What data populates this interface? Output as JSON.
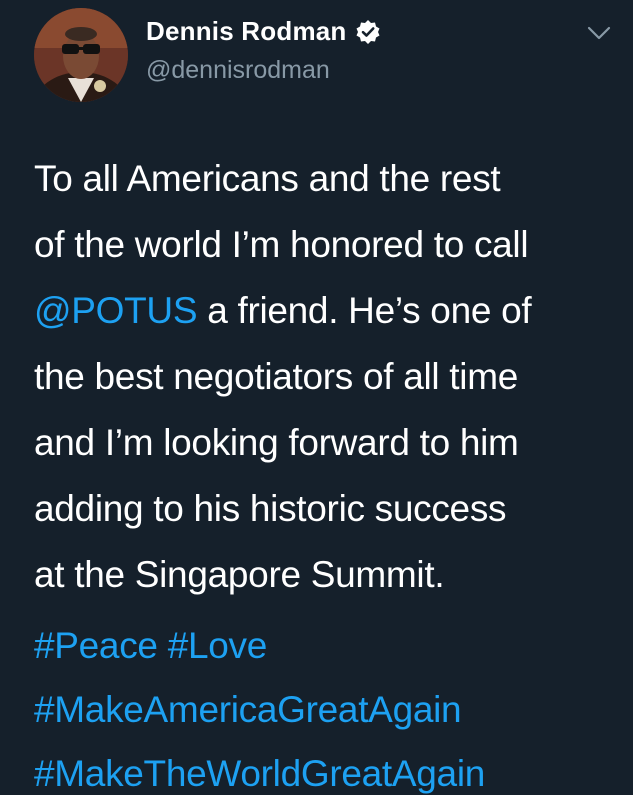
{
  "user": {
    "display_name": "Dennis Rodman",
    "handle": "@dennisrodman",
    "verified": true
  },
  "tweet": {
    "lines": [
      "To all Americans and the rest",
      "of the world I’m honored to call",
      "a friend. He’s one of",
      "the best negotiators of all time",
      "and I’m looking forward to him",
      "adding to his historic success",
      "at the Singapore Summit."
    ],
    "mention": "@POTUS",
    "hashtags": {
      "peace": "#Peace",
      "love": "#Love",
      "maga": "#MakeAmericaGreatAgain",
      "mtwga": "#MakeTheWorldGreatAgain"
    }
  },
  "icons": {
    "verified": "verified-badge-icon",
    "menu": "chevron-down-icon"
  },
  "colors": {
    "background": "#15202b",
    "text": "#ffffff",
    "secondary_text": "#8899a6",
    "link": "#1da1f2"
  }
}
